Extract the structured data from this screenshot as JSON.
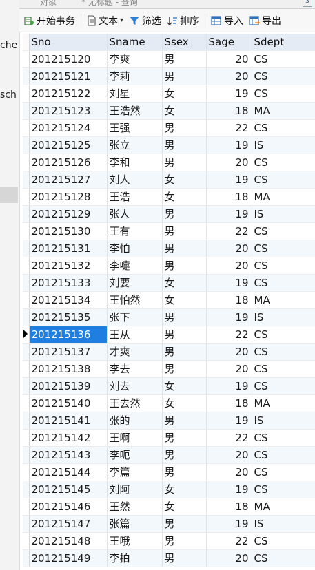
{
  "sidebar": {
    "fragments": [
      "che",
      "sch"
    ]
  },
  "tabs": [
    "对象",
    "* 无标题 - 查询"
  ],
  "toolbar": {
    "begin_transaction": "开始事务",
    "text": "文本",
    "filter": "筛选",
    "sort": "排序",
    "import": "导入",
    "export": "导出"
  },
  "table": {
    "columns": [
      "Sno",
      "Sname",
      "Ssex",
      "Sage",
      "Sdept"
    ],
    "selected_row": 16,
    "rows": [
      [
        "201215120",
        "李爽",
        "男",
        "20",
        "CS"
      ],
      [
        "201215121",
        "李莉",
        "男",
        "20",
        "CS"
      ],
      [
        "201215122",
        "刘星",
        "女",
        "19",
        "CS"
      ],
      [
        "201215123",
        "王浩然",
        "女",
        "18",
        "MA"
      ],
      [
        "201215124",
        "王强",
        "男",
        "22",
        "CS"
      ],
      [
        "201215125",
        "张立",
        "男",
        "19",
        "IS"
      ],
      [
        "201215126",
        "李和",
        "男",
        "20",
        "CS"
      ],
      [
        "201215127",
        "刘人",
        "女",
        "19",
        "CS"
      ],
      [
        "201215128",
        "王浩",
        "女",
        "18",
        "MA"
      ],
      [
        "201215129",
        "张人",
        "男",
        "19",
        "IS"
      ],
      [
        "201215130",
        "王有",
        "男",
        "22",
        "CS"
      ],
      [
        "201215131",
        "李怕",
        "男",
        "20",
        "CS"
      ],
      [
        "201215132",
        "李嚏",
        "男",
        "20",
        "CS"
      ],
      [
        "201215133",
        "刘要",
        "女",
        "19",
        "CS"
      ],
      [
        "201215134",
        "王怕然",
        "女",
        "18",
        "MA"
      ],
      [
        "201215135",
        "张下",
        "男",
        "19",
        "IS"
      ],
      [
        "201215136",
        "王从",
        "男",
        "22",
        "CS"
      ],
      [
        "201215137",
        "才爽",
        "男",
        "20",
        "CS"
      ],
      [
        "201215138",
        "李去",
        "男",
        "20",
        "CS"
      ],
      [
        "201215139",
        "刘去",
        "女",
        "19",
        "CS"
      ],
      [
        "201215140",
        "王去然",
        "女",
        "18",
        "MA"
      ],
      [
        "201215141",
        "张的",
        "男",
        "19",
        "IS"
      ],
      [
        "201215142",
        "王啊",
        "男",
        "22",
        "CS"
      ],
      [
        "201215143",
        "李呃",
        "男",
        "20",
        "CS"
      ],
      [
        "201215144",
        "李篇",
        "男",
        "20",
        "CS"
      ],
      [
        "201215145",
        "刘阿",
        "女",
        "19",
        "CS"
      ],
      [
        "201215146",
        "王然",
        "女",
        "18",
        "MA"
      ],
      [
        "201215147",
        "张篇",
        "男",
        "19",
        "IS"
      ],
      [
        "201215148",
        "王哦",
        "男",
        "22",
        "CS"
      ],
      [
        "201215149",
        "李拍",
        "男",
        "20",
        "CS"
      ]
    ]
  },
  "colors": {
    "header_bg": "#e4ebf5",
    "selected": "#1e7fe0",
    "alt_row": "#f3f8fd"
  },
  "icons": [
    "transaction-icon",
    "text-icon",
    "filter-icon",
    "sort-icon",
    "import-icon",
    "export-icon",
    "query-tab-icon",
    "row-pointer-icon"
  ]
}
